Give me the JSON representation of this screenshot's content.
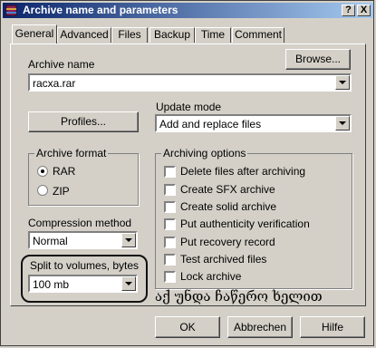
{
  "window": {
    "title": "Archive name and parameters",
    "help_btn": "?",
    "close_btn": "X"
  },
  "tabs": [
    "General",
    "Advanced",
    "Files",
    "Backup",
    "Time",
    "Comment"
  ],
  "archive_name": {
    "label": "Archive name",
    "value": "racxa.rar",
    "browse_label": "Browse..."
  },
  "update_mode": {
    "label": "Update mode",
    "value": "Add and replace files"
  },
  "profiles_label": "Profiles...",
  "archive_format": {
    "title": "Archive format",
    "options": [
      {
        "label": "RAR",
        "selected": true
      },
      {
        "label": "ZIP",
        "selected": false
      }
    ]
  },
  "archiving_options": {
    "title": "Archiving options",
    "items": [
      {
        "label": "Delete files after archiving",
        "checked": false
      },
      {
        "label": "Create SFX archive",
        "checked": false
      },
      {
        "label": "Create solid archive",
        "checked": false
      },
      {
        "label": "Put authenticity verification",
        "checked": false
      },
      {
        "label": "Put recovery record",
        "checked": false
      },
      {
        "label": "Test archived files",
        "checked": false
      },
      {
        "label": "Lock archive",
        "checked": false
      }
    ]
  },
  "compression": {
    "label": "Compression method",
    "value": "Normal"
  },
  "split": {
    "label": "Split to volumes, bytes",
    "value": "100 mb"
  },
  "annotation": "აქ უნდა ჩაწერო ხელით",
  "buttons": {
    "ok": "OK",
    "cancel": "Abbrechen",
    "help": "Hilfe"
  }
}
